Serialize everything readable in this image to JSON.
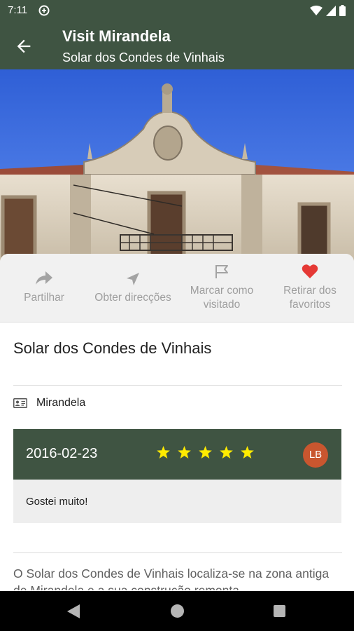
{
  "status_bar": {
    "time": "7:11"
  },
  "app_bar": {
    "title": "Visit Mirandela",
    "subtitle": "Solar dos Condes de Vinhais"
  },
  "actions": [
    {
      "label": "Partilhar",
      "icon": "share-icon"
    },
    {
      "label": "Obter direcções",
      "icon": "navigation-arrow-icon"
    },
    {
      "label": "Marcar como visitado",
      "icon": "flag-icon"
    },
    {
      "label": "Retirar dos favoritos",
      "icon": "heart-icon"
    }
  ],
  "place": {
    "title": "Solar dos Condes de Vinhais",
    "location": "Mirandela"
  },
  "review": {
    "date": "2016-02-23",
    "rating": 5,
    "avatar_initials": "LB",
    "text": "Gostei muito!"
  },
  "description": "O Solar dos Condes de Vinhais localiza-se na zona antiga de Mirandela e a sua construção remonta",
  "colors": {
    "primary": "#3f5442",
    "favorite": "#e53935",
    "star": "#ffeb00",
    "avatar": "#c9562f"
  }
}
